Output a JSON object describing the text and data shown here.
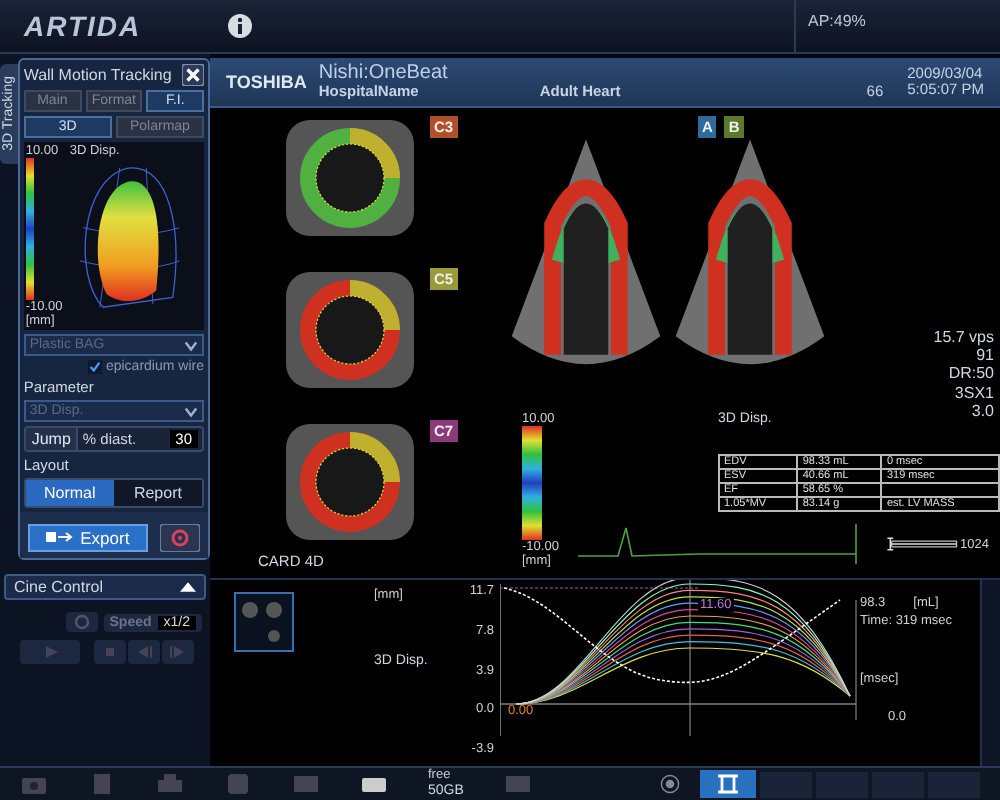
{
  "top_bar": {
    "logo": "ARTIDA",
    "status": "AP:49%"
  },
  "side_tab": {
    "label": "3D Tracking"
  },
  "panel": {
    "title": "Wall Motion Tracking",
    "tabs": [
      {
        "label": "Main",
        "selected": false
      },
      {
        "label": "Format",
        "selected": false
      },
      {
        "label": "F.I.",
        "selected": true
      }
    ],
    "subtabs": [
      {
        "label": "3D",
        "selected": true
      },
      {
        "label": "Polarmap",
        "selected": false
      }
    ],
    "scale_max": "10.00",
    "scale_label": "3D Disp.",
    "scale_min": "-10.00",
    "scale_unit": "[mm]",
    "model_dropdown": {
      "value": "Plastic BAG",
      "disabled": true
    },
    "epicardium": {
      "label": "epicardium wire",
      "checked": true
    },
    "parameter_label": "Parameter",
    "parameter_dropdown": {
      "value": "3D Disp.",
      "disabled": true
    },
    "jump_button": "Jump",
    "diast_label": "% diast.",
    "diast_value": "30",
    "layout_label": "Layout",
    "layout_options": [
      {
        "label": "Normal",
        "selected": true
      },
      {
        "label": "Report",
        "selected": false
      }
    ],
    "export_button": "Export"
  },
  "cine": {
    "title": "Cine Control",
    "speed_label": "Speed",
    "speed_value": "x1/2"
  },
  "header": {
    "brand": "TOSHIBA",
    "patient": "Nishi:OneBeat",
    "hospital": "HospitalName",
    "preset": "Adult Heart",
    "number": "66",
    "date": "2009/03/04",
    "time": "5:05:07 PM"
  },
  "short_axis": [
    {
      "label": "C3",
      "color": "#b0502a"
    },
    {
      "label": "C5",
      "color": "#9a9a38"
    },
    {
      "label": "C7",
      "color": "#8a3a78"
    }
  ],
  "apical": [
    {
      "label": "A",
      "color": "#2e6a9a"
    },
    {
      "label": "B",
      "color": "#5a7a2a"
    }
  ],
  "readouts": [
    "15.7 vps",
    "91",
    "DR:50",
    "3SX1",
    "3.0"
  ],
  "colorbar": {
    "max": "10.00",
    "min": "-10.00",
    "unit": "[mm]"
  },
  "param_label": "3D Disp.",
  "card_label": "CARD 4D",
  "table": {
    "rows": [
      [
        "EDV",
        "98.33 mL",
        "0 msec"
      ],
      [
        "ESV",
        "40.66 mL",
        "319 msec"
      ],
      [
        "EF",
        "58.65 %",
        ""
      ],
      [
        "1.05*MV",
        "83.14 g",
        "est. LV MASS"
      ]
    ]
  },
  "scale_value": "1024",
  "graph": {
    "y_unit": "[mm]",
    "y_ticks": [
      "11.7",
      "7.8",
      "3.9",
      "0.0",
      "-3.9"
    ],
    "param": "3D Disp.",
    "peak_label": "11.60",
    "zero_label": "0.00",
    "volume_max": "98.3",
    "volume_unit": "[mL]",
    "time_label": "Time: 319 msec",
    "time_unit": "[msec]",
    "volume_min": "0.0"
  },
  "storage": {
    "label": "free",
    "value": "50GB"
  }
}
